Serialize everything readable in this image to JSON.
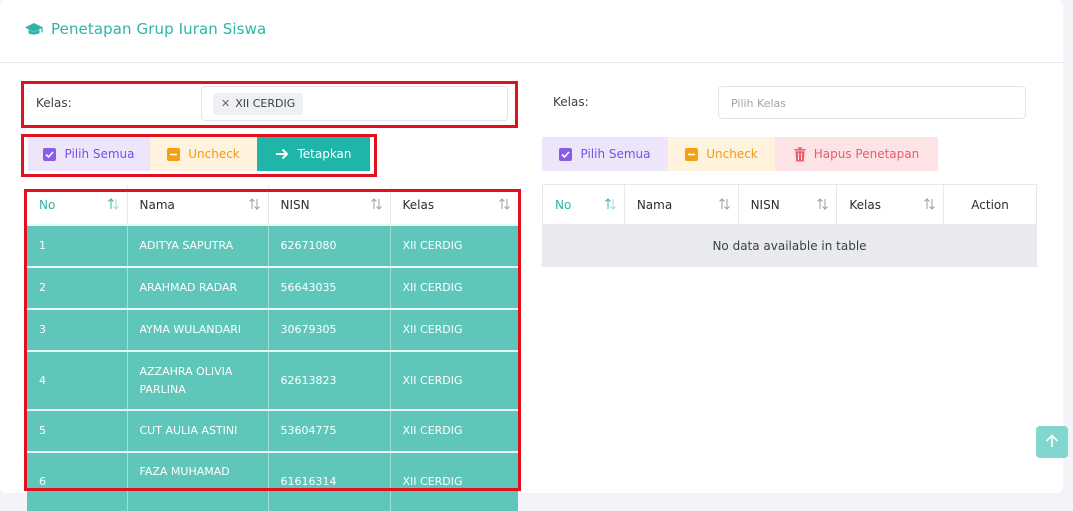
{
  "header": {
    "title": "Penetapan Grup Iuran Siswa",
    "icon": "graduation-cap-icon"
  },
  "left": {
    "kelas_label": "Kelas:",
    "selected_tag": "XII CERDIG",
    "buttons": {
      "select_all": "Pilih Semua",
      "uncheck": "Uncheck",
      "assign": "Tetapkan"
    },
    "columns": [
      "No",
      "Nama",
      "NISN",
      "Kelas"
    ],
    "rows": [
      {
        "no": "1",
        "nama": "ADITYA SAPUTRA",
        "nisn": "62671080",
        "kelas": "XII CERDIG"
      },
      {
        "no": "2",
        "nama": "ARAHMAD RADAR",
        "nisn": "56643035",
        "kelas": "XII CERDIG"
      },
      {
        "no": "3",
        "nama": "AYMA WULANDARI",
        "nisn": "30679305",
        "kelas": "XII CERDIG"
      },
      {
        "no": "4",
        "nama": "AZZAHRA OLIVIA PARLINA",
        "nisn": "62613823",
        "kelas": "XII CERDIG"
      },
      {
        "no": "5",
        "nama": "CUT AULIA ASTINI",
        "nisn": "53604775",
        "kelas": "XII CERDIG"
      },
      {
        "no": "6",
        "nama": "FAZA MUHAMAD",
        "nisn": "61616314",
        "kelas": "XII CERDIG"
      }
    ]
  },
  "right": {
    "kelas_label": "Kelas:",
    "placeholder": "Pilih Kelas",
    "buttons": {
      "select_all": "Pilih Semua",
      "uncheck": "Uncheck",
      "remove": "Hapus Penetapan"
    },
    "columns": [
      "No",
      "Nama",
      "NISN",
      "Kelas",
      "Action"
    ],
    "empty_message": "No data available in table"
  },
  "colors": {
    "accent": "#2fb3a8",
    "row_selected": "#5fc6ba",
    "highlight": "#e0101e"
  }
}
